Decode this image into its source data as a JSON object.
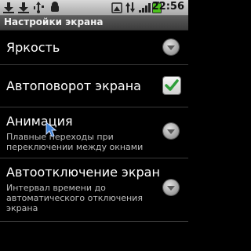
{
  "status_bar": {
    "time": "22:56",
    "icons": [
      "download-icon",
      "download-icon",
      "usb-icon",
      "data-activity-icon",
      "battery-icon"
    ]
  },
  "title": "Настройки экрана",
  "settings": [
    {
      "title": "Яркость",
      "summary": "",
      "control": "dropdown"
    },
    {
      "title": "Автоповорот экрана",
      "summary": "",
      "control": "checkbox",
      "checked": true
    },
    {
      "title": "Анимация",
      "summary": "Плавные переходы при\nпереключении между окнами",
      "control": "dropdown"
    },
    {
      "title": "Автоотключение экран",
      "summary": "Интервал времени до\nавтоматического отключения\nэкрана",
      "control": "dropdown"
    }
  ],
  "colors": {
    "background": "#000000",
    "check": "#2e9e3a",
    "battery": "#4cc21c"
  }
}
